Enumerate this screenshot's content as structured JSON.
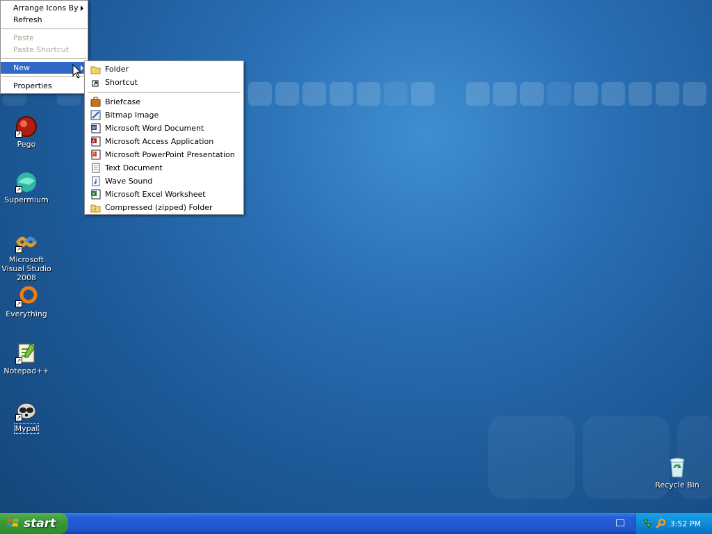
{
  "desktop": {
    "icons": [
      {
        "label": "Pego"
      },
      {
        "label": "Supermium"
      },
      {
        "label": "Microsoft Visual Studio 2008"
      },
      {
        "label": "Everything"
      },
      {
        "label": "Notepad++"
      },
      {
        "label": "Mypal"
      },
      {
        "label": "Recycle Bin"
      }
    ]
  },
  "context_menu": {
    "items": [
      {
        "label": "Arrange Icons By"
      },
      {
        "label": "Refresh"
      },
      {
        "label": "Paste"
      },
      {
        "label": "Paste Shortcut"
      },
      {
        "label": "New"
      },
      {
        "label": "Properties"
      }
    ]
  },
  "new_menu": {
    "items": [
      {
        "label": "Folder",
        "icon": "folder-icon"
      },
      {
        "label": "Shortcut",
        "icon": "shortcut-icon"
      },
      {
        "label": "Briefcase",
        "icon": "briefcase-icon"
      },
      {
        "label": "Bitmap Image",
        "icon": "bitmap-icon"
      },
      {
        "label": "Microsoft Word Document",
        "icon": "word-icon"
      },
      {
        "label": "Microsoft Access Application",
        "icon": "access-icon"
      },
      {
        "label": "Microsoft PowerPoint Presentation",
        "icon": "powerpoint-icon"
      },
      {
        "label": "Text Document",
        "icon": "text-document-icon"
      },
      {
        "label": "Wave Sound",
        "icon": "wave-sound-icon"
      },
      {
        "label": "Microsoft Excel Worksheet",
        "icon": "excel-icon"
      },
      {
        "label": "Compressed (zipped) Folder",
        "icon": "zip-folder-icon"
      }
    ]
  },
  "taskbar": {
    "start_label": "start",
    "clock": "3:52 PM"
  }
}
